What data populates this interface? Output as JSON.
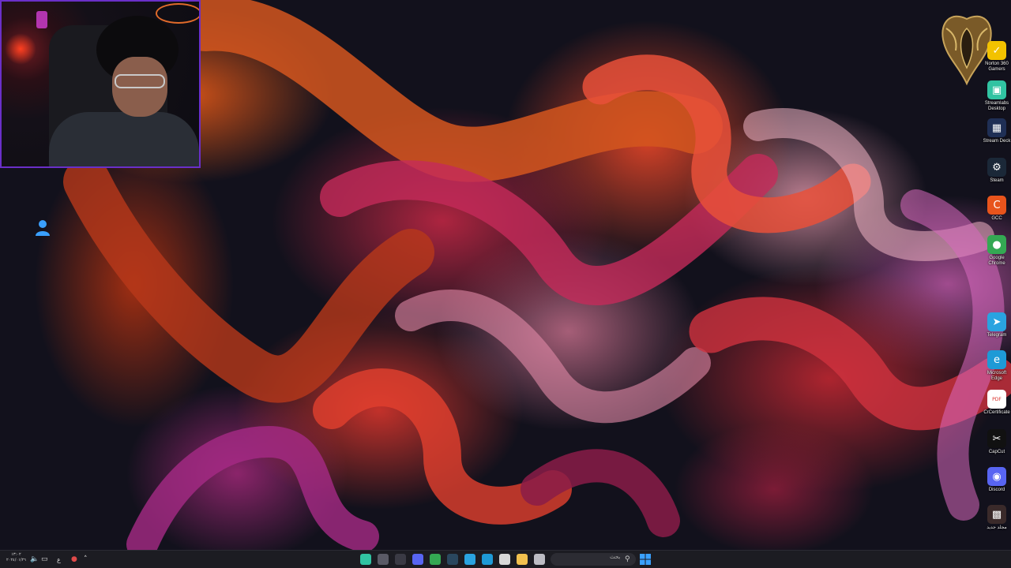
{
  "desktop": {
    "wallpaper": "abstract-ribbons",
    "accent_colors": [
      "#d65418",
      "#c8284a",
      "#e6a0b4",
      "#a0287a",
      "#12111c"
    ]
  },
  "webcam": {
    "border_color": "#6a2fc8"
  },
  "desktop_icons": [
    {
      "name": "Norton 360 for Gamers",
      "label": "Norton 360 Gamers",
      "icon": "norton-icon",
      "color": "#f2c200"
    },
    {
      "name": "Streamlabs Desktop",
      "label": "Streamlabs Desktop",
      "icon": "streamlabs-icon",
      "color": "#31c3a2"
    },
    {
      "name": "Stream Deck",
      "label": "Stream Deck",
      "icon": "stream-deck-icon",
      "color": "#1f2f55"
    },
    {
      "name": "Steam",
      "label": "Steam",
      "icon": "steam-icon",
      "color": "#1b2838"
    },
    {
      "name": "GCC",
      "label": "GCC",
      "icon": "gcc-icon",
      "color": "#e8541c"
    },
    {
      "name": "Google Chrome",
      "label": "Google Chrome",
      "icon": "chrome-icon",
      "color": "#34a853"
    },
    {
      "name": "Telegram",
      "label": "Telegram",
      "icon": "telegram-icon",
      "color": "#2aa3e0"
    },
    {
      "name": "Microsoft Edge",
      "label": "Microsoft Edge",
      "icon": "edge-icon",
      "color": "#1e9ad6"
    },
    {
      "name": "CrCertificate",
      "label": "CrCertificate",
      "icon": "pdf-icon",
      "color": "#d9302a"
    },
    {
      "name": "CapCut",
      "label": "CapCut",
      "icon": "capcut-icon",
      "color": "#111111"
    },
    {
      "name": "Discord",
      "label": "Discord",
      "icon": "discord-icon",
      "color": "#5865f2"
    },
    {
      "name": "Cursor Folder",
      "label": "ﻣﺠﻠﺪ ﺟﺪﻳﺪ",
      "icon": "folder-thumbnail-icon",
      "color": "#3a2a2a"
    }
  ],
  "taskbar": {
    "clock_time": "١٣:٠٢",
    "clock_date": "٢٠٢٤/٠١/٢٦",
    "tray_icons": [
      "speaker-icon",
      "display-icon",
      "language-indicator",
      "microphone-icon",
      "chevron-up-icon"
    ],
    "language": "ع",
    "search_placeholder": "بحث",
    "apps": [
      {
        "name": "streamlabs",
        "icon": "streamlabs-icon",
        "color": "#31c3a2"
      },
      {
        "name": "app-2",
        "icon": "app-icon",
        "color": "#5a5a66"
      },
      {
        "name": "app-3",
        "icon": "app-icon",
        "color": "#3a3a44"
      },
      {
        "name": "discord",
        "icon": "discord-icon",
        "color": "#5865f2"
      },
      {
        "name": "chrome",
        "icon": "chrome-icon",
        "color": "#34a853"
      },
      {
        "name": "steam",
        "icon": "steam-icon",
        "color": "#2a475e"
      },
      {
        "name": "telegram",
        "icon": "telegram-icon",
        "color": "#2aa3e0"
      },
      {
        "name": "edge",
        "icon": "edge-icon",
        "color": "#1e9ad6"
      },
      {
        "name": "store",
        "icon": "store-icon",
        "color": "#d8d8d8"
      },
      {
        "name": "file-explorer",
        "icon": "folder-icon",
        "color": "#f2c14e"
      },
      {
        "name": "app-11",
        "icon": "app-icon",
        "color": "#bdbdc4"
      }
    ],
    "start_color": "#3aa0ff"
  }
}
